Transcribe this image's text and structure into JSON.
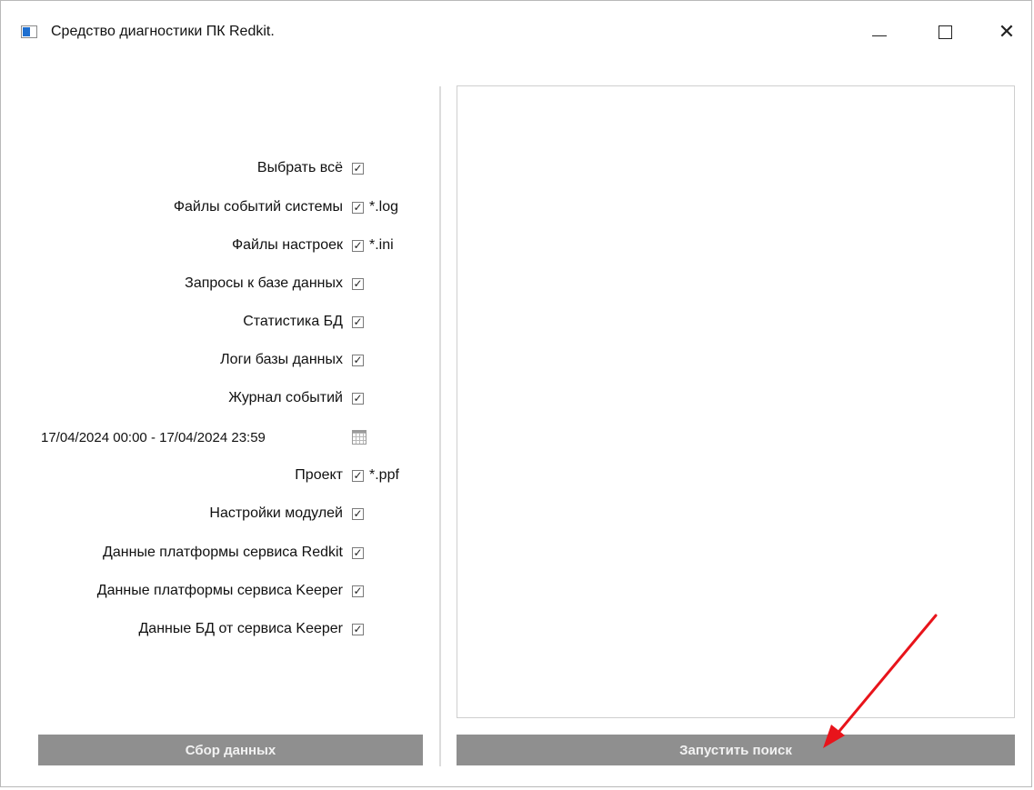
{
  "window": {
    "title": "Средство диагностики ПК Redkit.",
    "minimize_glyph": "",
    "close_glyph": "✕"
  },
  "options": [
    {
      "label": "Выбрать всё",
      "checked": true,
      "ext": ""
    },
    {
      "label": "Файлы событий системы",
      "checked": true,
      "ext": "*.log"
    },
    {
      "label": "Файлы настроек",
      "checked": true,
      "ext": "*.ini"
    },
    {
      "label": "Запросы к базе данных",
      "checked": true,
      "ext": ""
    },
    {
      "label": "Статистика БД",
      "checked": true,
      "ext": ""
    },
    {
      "label": "Логи базы данных",
      "checked": true,
      "ext": ""
    },
    {
      "label": "Журнал событий",
      "checked": true,
      "ext": ""
    },
    {
      "label": "Проект",
      "checked": true,
      "ext": "*.ppf"
    },
    {
      "label": "Настройки модулей",
      "checked": true,
      "ext": ""
    },
    {
      "label": "Данные платформы сервиса Redkit",
      "checked": true,
      "ext": ""
    },
    {
      "label": "Данные платформы сервиса Keeper",
      "checked": true,
      "ext": ""
    },
    {
      "label": "Данные БД от сервиса Keeper",
      "checked": true,
      "ext": ""
    }
  ],
  "date_range": "17/04/2024 00:00 - 17/04/2024 23:59",
  "check_glyph": "✓",
  "buttons": {
    "collect": "Сбор данных",
    "search": "Запустить поиск"
  },
  "colors": {
    "button_bg": "#8f8f8f",
    "button_text": "#f2f2f2",
    "annotation_arrow": "#e8141b"
  }
}
